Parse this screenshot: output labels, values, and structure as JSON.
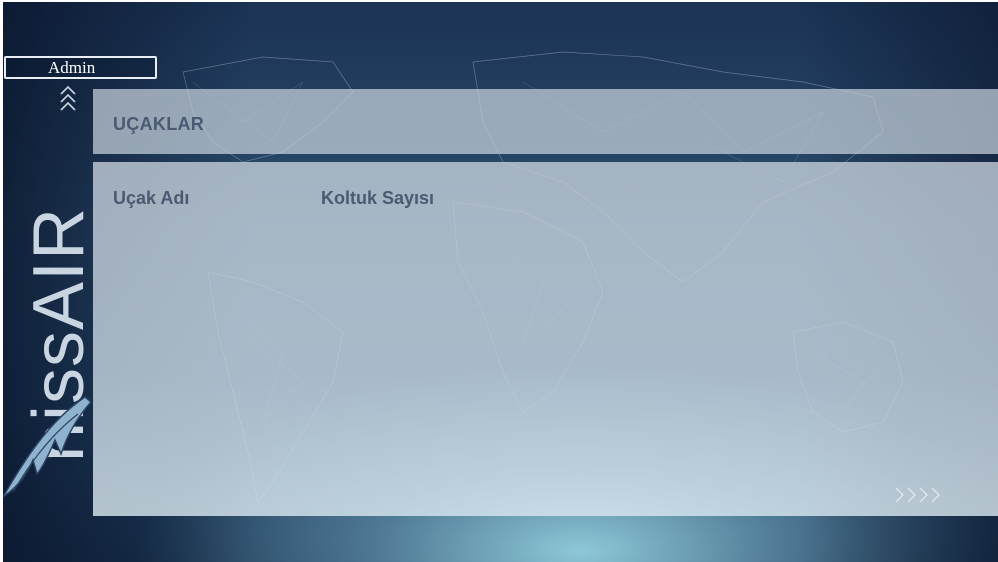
{
  "user": {
    "label": "Admin"
  },
  "brand": {
    "name": "nissAIR"
  },
  "page": {
    "title": "UÇAKLAR"
  },
  "table": {
    "columns": [
      "Uçak Adı",
      "Koltuk Sayısı"
    ]
  },
  "icons": {
    "collapse": "chevron-double-up-icon",
    "next": "chevron-quad-right-icon"
  },
  "colors": {
    "panel_text": "#4b5a72",
    "background": "#1b3354",
    "glow": "#8ec8d8"
  }
}
